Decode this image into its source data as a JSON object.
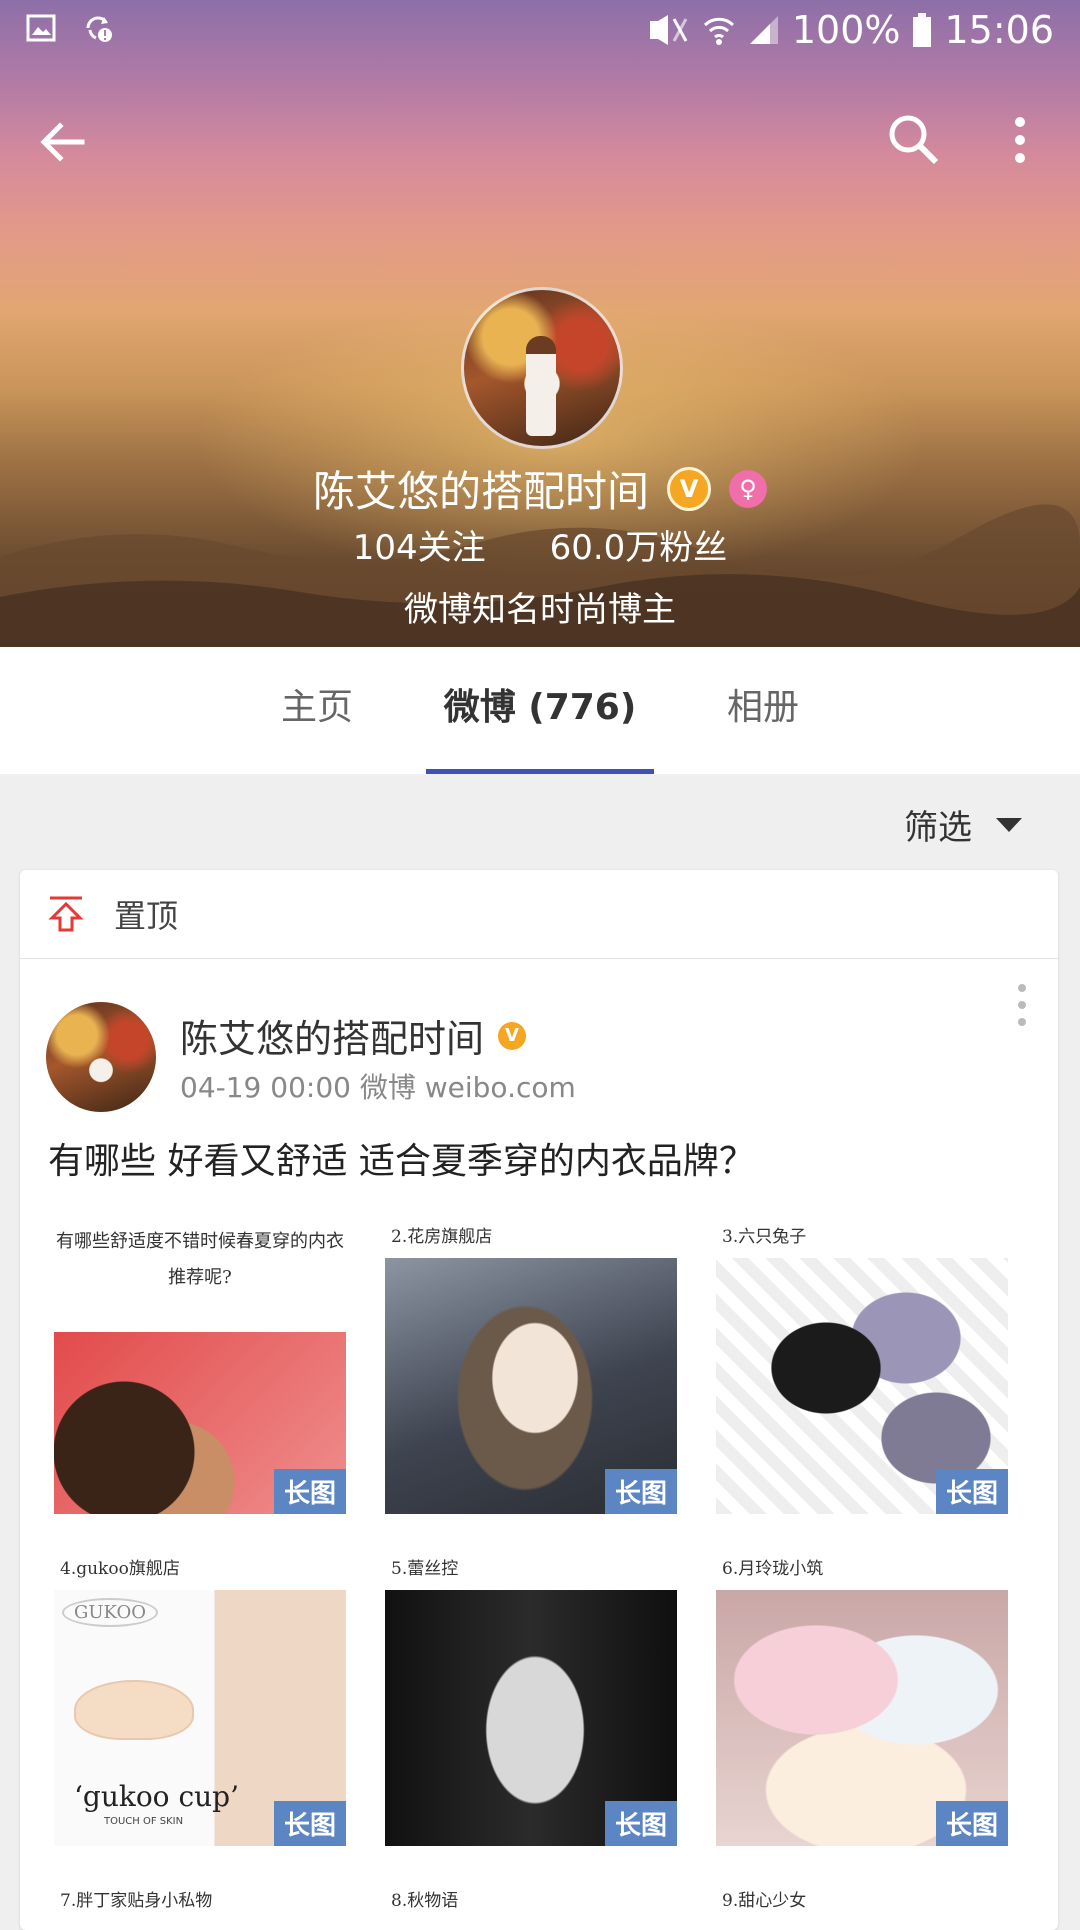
{
  "status_bar": {
    "battery": "100%",
    "time": "15:06",
    "icons": [
      "gallery-icon",
      "sync-alert-icon",
      "mute-icon",
      "wifi-icon",
      "signal-icon",
      "battery-icon"
    ]
  },
  "profile": {
    "name": "陈艾悠的搭配时间",
    "verified_badge": "V",
    "following": "104关注",
    "followers": "60.0万粉丝",
    "bio": "微博知名时尚博主"
  },
  "tabs": [
    {
      "label": "主页",
      "active": false
    },
    {
      "label": "微博 (776)",
      "active": true
    },
    {
      "label": "相册",
      "active": false
    }
  ],
  "filter": {
    "label": "筛选"
  },
  "pinned": {
    "label": "置顶"
  },
  "post": {
    "author": "陈艾悠的搭配时间",
    "verified_badge": "V",
    "meta": "04-19 00:00 微博 weibo.com",
    "text": "有哪些 好看又舒适 适合夏季穿的内衣品牌？",
    "images": [
      {
        "caption": "",
        "question": "有哪些舒适度不错时候春夏穿的内衣推荐呢?",
        "tag": "长图"
      },
      {
        "caption": "2.花房旗舰店",
        "tag": "长图"
      },
      {
        "caption": "3.六只兔子",
        "tag": "长图"
      },
      {
        "caption": "4.gukoo旗舰店",
        "logo": "GUKOO",
        "product_text": "‘gukoo cup’",
        "product_sub": "TOUCH OF SKIN",
        "tag": "长图"
      },
      {
        "caption": "5.蕾丝控",
        "tag": "长图"
      },
      {
        "caption": "6.月玲珑小筑",
        "tag": "长图"
      }
    ],
    "next_captions": [
      "7.胖丁家贴身小私物",
      "8.秋物语",
      "9.甜心少女"
    ]
  },
  "colors": {
    "tab_indicator": "#3f51b5",
    "verified": "#f5a623",
    "gender": "#f06ea9",
    "long_image_tag": "#5b85c3",
    "pin_icon": "#e53935"
  }
}
